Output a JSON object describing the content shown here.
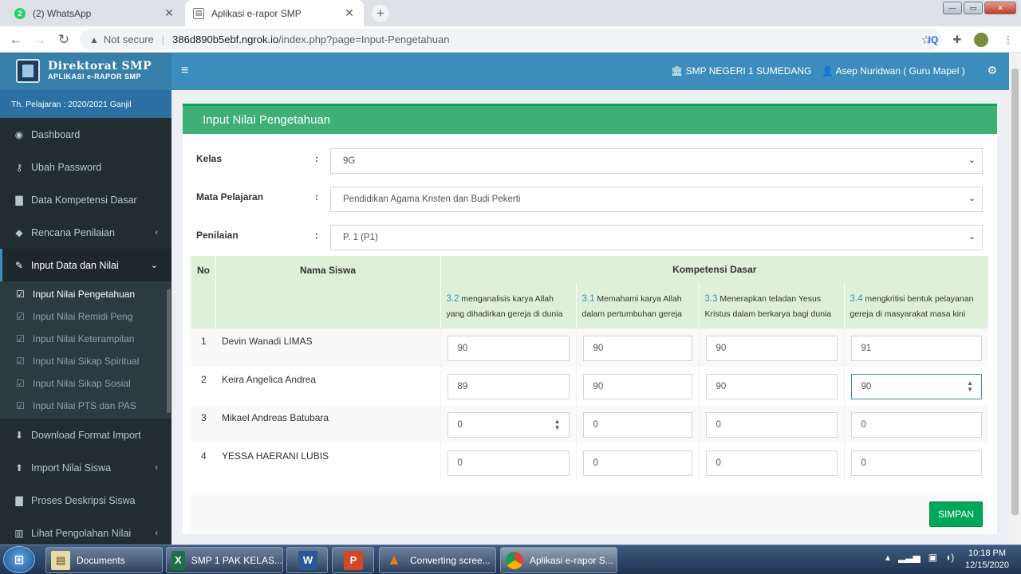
{
  "browser": {
    "tabs": [
      {
        "title": "(2) WhatsApp",
        "badge": "2"
      },
      {
        "title": "Aplikasi e-rapor SMP"
      }
    ],
    "url_notice": "Not secure",
    "url_host": "386d890b5ebf.ngrok.io",
    "url_path": "/index.php?page=Input-Pengetahuan",
    "ext_iq": "IQ"
  },
  "app": {
    "logo_line1": "Direktorat SMP",
    "logo_line2": "APLIKASI e-RAPOR SMP",
    "school": "SMP NEGERI 1 SUMEDANG",
    "user": "Asep Nuridwan ( Guru Mapel )",
    "year": "Th. Pelajaran : 2020/2021 Ganjil"
  },
  "sidebar": {
    "items": [
      {
        "label": "Dashboard",
        "icon": "dashboard-icon"
      },
      {
        "label": "Ubah Password",
        "icon": "key-icon"
      },
      {
        "label": "Data Kompetensi Dasar",
        "icon": "file-icon"
      },
      {
        "label": "Rencana Penilaian",
        "icon": "tags-icon"
      },
      {
        "label": "Input Data dan Nilai",
        "icon": "edit-icon"
      }
    ],
    "subitems": [
      {
        "label": "Input Nilai Pengetahuan"
      },
      {
        "label": "Input Nilai Remidi Peng"
      },
      {
        "label": "Input Nilai Keterampilan"
      },
      {
        "label": "Input Nilai Sikap Spiritual"
      },
      {
        "label": "Input Nilai Sikap Sosial"
      },
      {
        "label": "Input Nilai PTS dan PAS"
      }
    ],
    "items_after": [
      {
        "label": "Download Format Import"
      },
      {
        "label": "Import Nilai Siswa"
      },
      {
        "label": "Proses Deskripsi Siswa"
      },
      {
        "label": "Lihat Pengolahan Nilai"
      }
    ]
  },
  "main": {
    "title": "Input Nilai Pengetahuan",
    "form": {
      "kelas_label": "Kelas",
      "kelas_value": "9G",
      "mapel_label": "Mata Pelajaran",
      "mapel_value": "Pendidikan Agama Kristen dan Budi Pekerti",
      "penilaian_label": "Penilaian",
      "penilaian_value": "P. 1 (P1)",
      "colon": ":"
    },
    "table": {
      "col_no": "No",
      "col_name": "Nama Siswa",
      "col_kd": "Kompetensi Dasar",
      "kd": [
        {
          "code": "3.2",
          "line1": "menganalisis karya Allah",
          "line2": "yang dihadirkan gereja di dunia"
        },
        {
          "code": "3.1",
          "line1": "Memahami karya Allah",
          "line2": "dalam pertumbuhan gereja"
        },
        {
          "code": "3.3",
          "line1": "Menerapkan teladan Yesus",
          "line2": "Kristus dalam berkarya bagi dunia"
        },
        {
          "code": "3.4",
          "line1": "mengkritisi bentuk pelayanan",
          "line2": "gereja di masyarakat masa kini"
        }
      ],
      "rows": [
        {
          "no": "1",
          "name": "Devin Wanadi LIMAS",
          "scores": [
            "90",
            "90",
            "90",
            "91"
          ]
        },
        {
          "no": "2",
          "name": "Keira Angelica Andrea",
          "scores": [
            "89",
            "90",
            "90",
            "90"
          ]
        },
        {
          "no": "3",
          "name": "Mikael Andreas Batubara",
          "scores": [
            "0",
            "0",
            "0",
            "0"
          ]
        },
        {
          "no": "4",
          "name": "YESSA HAERANI LUBIS",
          "scores": [
            "0",
            "0",
            "0",
            "0"
          ]
        }
      ]
    },
    "save_label": "SIMPAN"
  },
  "taskbar": {
    "items": [
      {
        "label": "Documents"
      },
      {
        "label": "SMP 1 PAK KELAS..."
      },
      {
        "label": ""
      },
      {
        "label": ""
      },
      {
        "label": "Converting scree..."
      },
      {
        "label": "Aplikasi e-rapor S..."
      }
    ],
    "time": "10:18 PM",
    "date": "12/15/2020"
  },
  "colors": {
    "header_blue": "#3c8dbc",
    "sidebar_dark": "#222d32",
    "box_green": "#3eb075",
    "save_green": "#00a65a",
    "table_head": "#dff0d8"
  }
}
